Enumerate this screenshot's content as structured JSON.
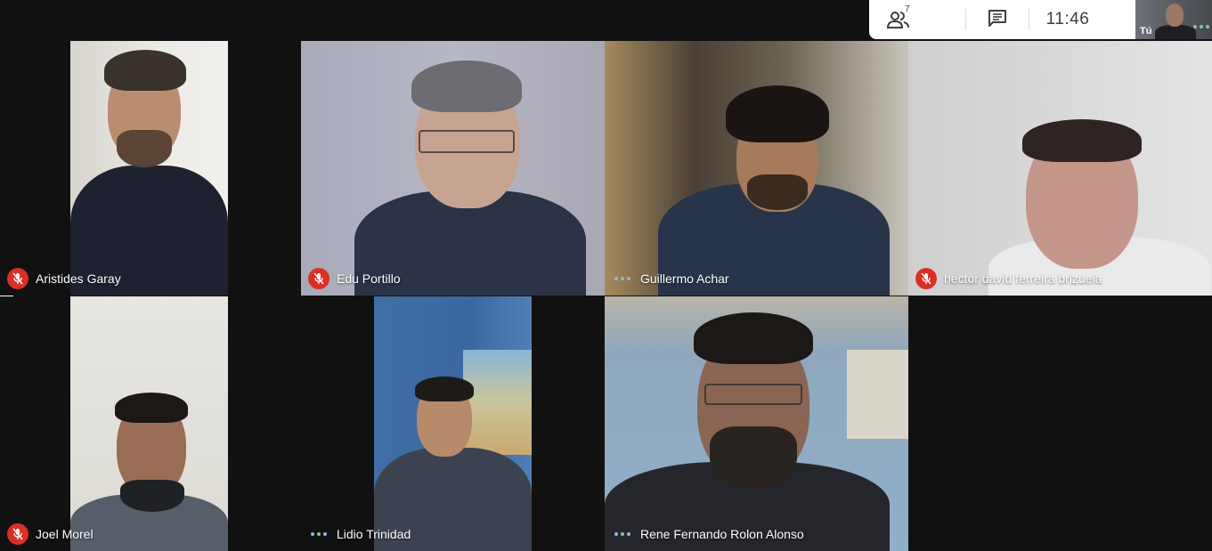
{
  "top_bar": {
    "participants_count": "7",
    "time": "11:46",
    "icons": [
      "people-icon",
      "chat-icon"
    ]
  },
  "self_view": {
    "label": "Tú"
  },
  "participants": [
    {
      "name": "Aristides Garay",
      "status": "muted"
    },
    {
      "name": "Edu Portillo",
      "status": "muted"
    },
    {
      "name": "Guillermo Achar",
      "status": "speaking-dots"
    },
    {
      "name": "hector david ferreira brizuela",
      "status": "muted"
    },
    {
      "name": "Joel Morel",
      "status": "muted"
    },
    {
      "name": "Lidio Trinidad",
      "status": "speaking-dots"
    },
    {
      "name": "Rene Fernando Rolon Alonso",
      "status": "speaking-dots"
    }
  ],
  "colors": {
    "background": "#111111",
    "muted_badge": "#d93025",
    "dots_blue": "#8ab4f8",
    "dots_green": "#81c995",
    "top_bar": "#ffffff"
  }
}
